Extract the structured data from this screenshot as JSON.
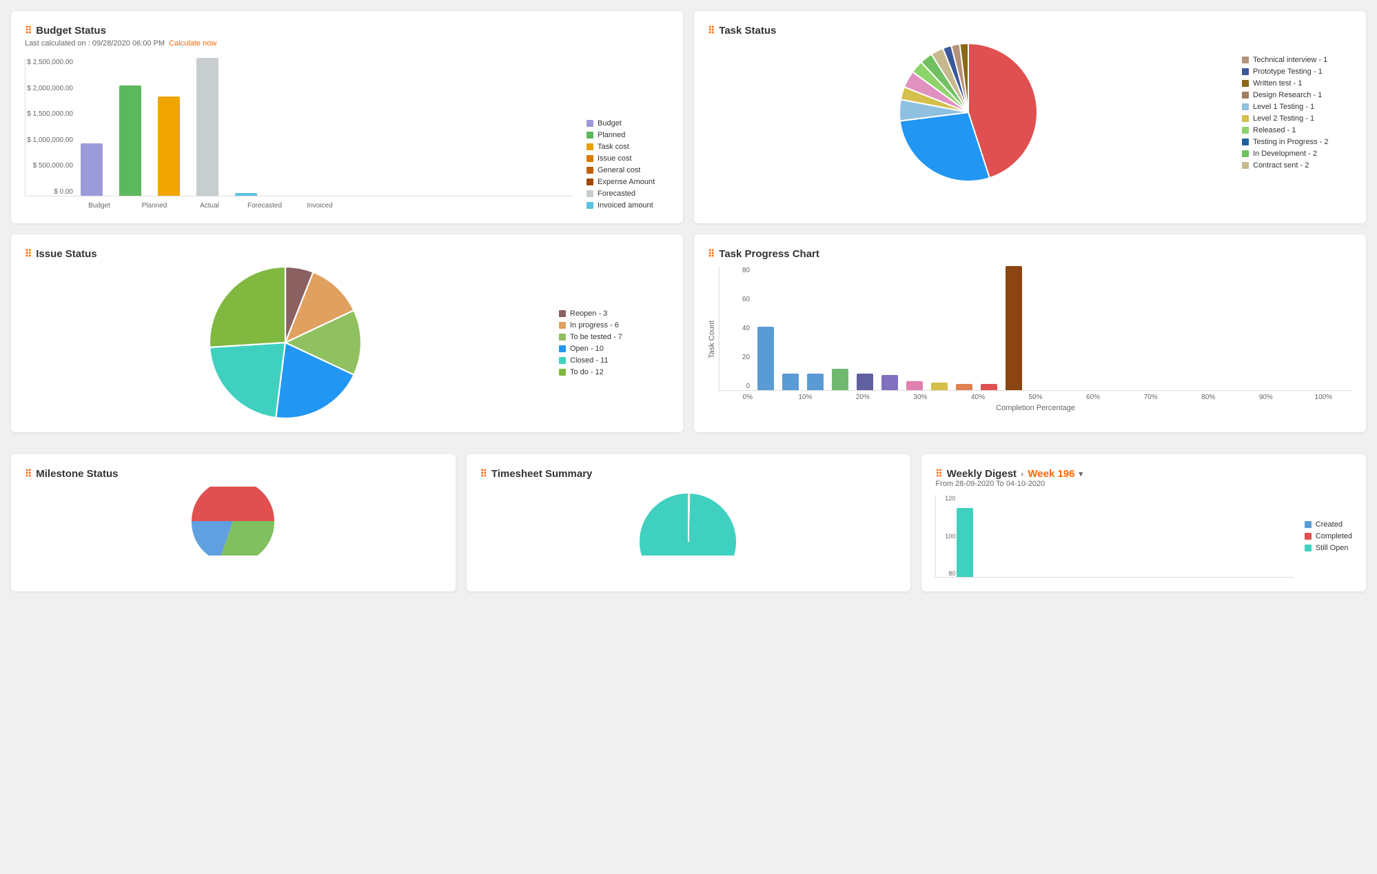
{
  "budget": {
    "title": "Budget Status",
    "subtitle": "Last calculated on : 09/28/2020 06:00 PM",
    "calc_now": "Calculate now",
    "bars": [
      {
        "label": "Budget",
        "value": 1000000,
        "color": "#9b9bda",
        "heightPct": 38
      },
      {
        "label": "Planned",
        "value": 2100000,
        "color": "#5cb85c",
        "heightPct": 80
      },
      {
        "label": "Actual",
        "value": 1900000,
        "color": "#f0a500",
        "heightPct": 72
      },
      {
        "label": "Forecasted",
        "value": 2600000,
        "color": "#c8cdd0",
        "heightPct": 100
      },
      {
        "label": "Invoiced",
        "value": 50000,
        "color": "#5bc0de",
        "heightPct": 2
      }
    ],
    "y_labels": [
      "$ 2,500,000.00",
      "$ 2,000,000.00",
      "$ 1,500,000.00",
      "$ 1,000,000.00",
      "$ 500,000.00",
      "$ 0.00"
    ],
    "legend": [
      {
        "label": "Budget",
        "color": "#9b9bda"
      },
      {
        "label": "Planned",
        "color": "#5cb85c"
      },
      {
        "label": "Task cost",
        "color": "#e8a000"
      },
      {
        "label": "Issue cost",
        "color": "#d97b00"
      },
      {
        "label": "General cost",
        "color": "#c06000"
      },
      {
        "label": "Expense Amount",
        "color": "#a04800"
      },
      {
        "label": "Forecasted",
        "color": "#c8cdd0"
      },
      {
        "label": "Invoiced amount",
        "color": "#5bc0de"
      }
    ]
  },
  "task_status": {
    "title": "Task Status",
    "legend": [
      {
        "label": "Technical interview - 1",
        "color": "#b5927a"
      },
      {
        "label": "Prototype Testing - 1",
        "color": "#3b5998"
      },
      {
        "label": "Written test - 1",
        "color": "#8b6914"
      },
      {
        "label": "Design Research - 1",
        "color": "#a08060"
      },
      {
        "label": "Level 1 Testing - 1",
        "color": "#90c0e0"
      },
      {
        "label": "Level 2 Testing - 1",
        "color": "#d4c04a"
      },
      {
        "label": "Released - 1",
        "color": "#8fd46a"
      },
      {
        "label": "Testing in Progress - 2",
        "color": "#2060a0"
      },
      {
        "label": "In Development - 2",
        "color": "#70c060"
      },
      {
        "label": "Contract sent - 2",
        "color": "#c8b890"
      }
    ],
    "pie_segments": [
      {
        "color": "#e05050",
        "pct": 45
      },
      {
        "color": "#2196F3",
        "pct": 28
      },
      {
        "color": "#90c0e0",
        "pct": 5
      },
      {
        "color": "#d4c04a",
        "pct": 3
      },
      {
        "color": "#e091c0",
        "pct": 4
      },
      {
        "color": "#8fd46a",
        "pct": 3
      },
      {
        "color": "#70c060",
        "pct": 3
      },
      {
        "color": "#c8b890",
        "pct": 3
      },
      {
        "color": "#3b5998",
        "pct": 2
      },
      {
        "color": "#b5927a",
        "pct": 2
      },
      {
        "color": "#8b6914",
        "pct": 2
      }
    ]
  },
  "issue_status": {
    "title": "Issue Status",
    "legend": [
      {
        "label": "Reopen - 3",
        "color": "#8b6060"
      },
      {
        "label": "In progress - 6",
        "color": "#e0a060"
      },
      {
        "label": "To be tested - 7",
        "color": "#90c060"
      },
      {
        "label": "Open - 10",
        "color": "#2196F3"
      },
      {
        "label": "Closed - 11",
        "color": "#40d0c0"
      },
      {
        "label": "To do - 12",
        "color": "#80b840"
      }
    ],
    "pie_segments": [
      {
        "color": "#8b6060",
        "pct": 6
      },
      {
        "color": "#e0a060",
        "pct": 12
      },
      {
        "color": "#90c060",
        "pct": 14
      },
      {
        "color": "#2196F3",
        "pct": 20
      },
      {
        "color": "#40d0c0",
        "pct": 22
      },
      {
        "color": "#80b840",
        "pct": 26
      }
    ]
  },
  "task_progress": {
    "title": "Task Progress Chart",
    "y_labels": [
      "80",
      "60",
      "40",
      "20",
      "0"
    ],
    "x_labels": [
      "0%",
      "10%",
      "20%",
      "30%",
      "40%",
      "50%",
      "60%",
      "70%",
      "80%",
      "90%",
      "100%"
    ],
    "x_axis_title": "Completion Percentage",
    "y_axis_title": "Task Count",
    "bars": [
      {
        "color": "#5b9bd5",
        "heightPct": 52,
        "value": 42
      },
      {
        "color": "#5b9bd5",
        "heightPct": 14,
        "value": 11
      },
      {
        "color": "#5b9bd5",
        "heightPct": 14,
        "value": 11
      },
      {
        "color": "#70b870",
        "heightPct": 18,
        "value": 14
      },
      {
        "color": "#6060a0",
        "heightPct": 14,
        "value": 11
      },
      {
        "color": "#8070c0",
        "heightPct": 12,
        "value": 10
      },
      {
        "color": "#e080b0",
        "heightPct": 8,
        "value": 6
      },
      {
        "color": "#d4c04a",
        "heightPct": 6,
        "value": 5
      },
      {
        "color": "#e08050",
        "heightPct": 5,
        "value": 4
      },
      {
        "color": "#e05050",
        "heightPct": 5,
        "value": 4
      },
      {
        "color": "#8b4513",
        "heightPct": 100,
        "value": 82
      }
    ]
  },
  "milestone": {
    "title": "Milestone Status"
  },
  "timesheet": {
    "title": "Timesheet Summary"
  },
  "weekly": {
    "title": "Weekly Digest",
    "week": "Week 196",
    "date_range": "From 28-09-2020 To 04-10-2020",
    "y_labels": [
      "120",
      "100",
      "80"
    ],
    "legend": [
      {
        "label": "Created",
        "color": "#5b9bd5"
      },
      {
        "label": "Completed",
        "color": "#e05050"
      },
      {
        "label": "Still Open",
        "color": "#40d0c0"
      }
    ],
    "bars": [
      {
        "color": "#40d0c0",
        "heightPct": 100
      }
    ]
  }
}
